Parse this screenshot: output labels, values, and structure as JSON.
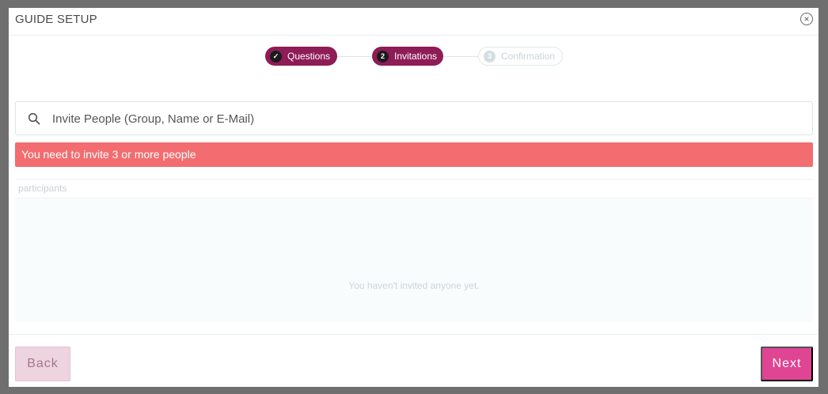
{
  "header": {
    "title": "GUIDE SETUP",
    "close_glyph": "×"
  },
  "steps": [
    {
      "label": "Questions",
      "marker": "✓",
      "state": "completed"
    },
    {
      "label": "Invitations",
      "marker": "2",
      "state": "active"
    },
    {
      "label": "Confirmation",
      "marker": "3",
      "state": "upcoming"
    }
  ],
  "search": {
    "placeholder": "Invite People (Group, Name or E-Mail)",
    "value": ""
  },
  "alert": {
    "text": "You need to invite 3 or more people",
    "color": "#f36d70"
  },
  "participants": {
    "label": "participants",
    "empty_text": "You haven't invited anyone yet."
  },
  "footer": {
    "back_label": "Back",
    "next_label": "Next"
  },
  "colors": {
    "step_active": "#8e1c57",
    "primary_button": "#e04594"
  }
}
